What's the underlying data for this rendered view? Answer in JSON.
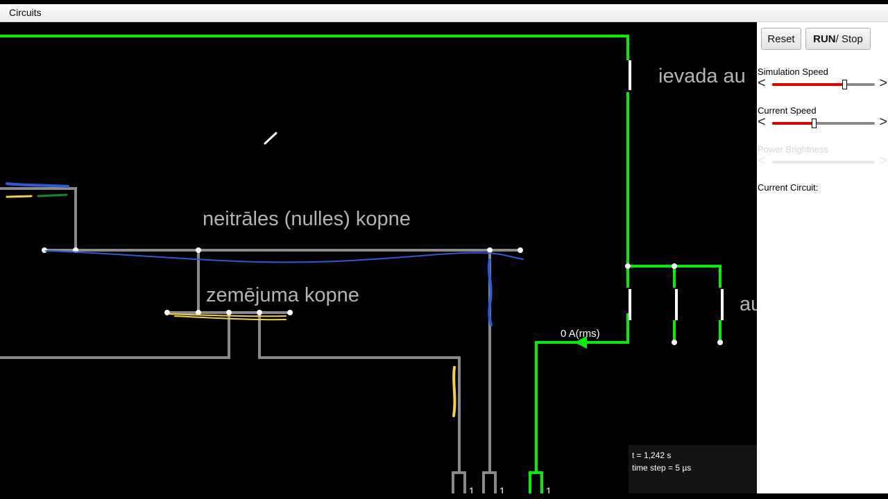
{
  "menubar": {
    "circuits_label": "Circuits"
  },
  "canvas": {
    "label_neutral_bus": "neitrāles (nulles) kopne",
    "label_ground_bus": "zemējuma kopne",
    "label_input": "ievada au",
    "label_right": "au",
    "current_readout": "0 A(rms)",
    "terminal_labels": [
      "1",
      "1",
      "1"
    ],
    "colors": {
      "live_wire": "#00ee00",
      "neutral_wire": "#8a8a8a",
      "blue_mark": "#2a5bd8",
      "yellow_mark": "#f2d23c",
      "green_mark": "#0a8a2a"
    }
  },
  "info": {
    "time": "t = 1,242 s",
    "time_step": "time step = 5 µs"
  },
  "panel": {
    "reset_label": "Reset",
    "run_label": "RUN",
    "stop_label": " / Stop",
    "simulation_speed_label": "Simulation Speed",
    "simulation_speed_value": 0.71,
    "current_speed_label": "Current Speed",
    "current_speed_value": 0.41,
    "power_brightness_label": "Power Brightness",
    "current_circuit_label": "Current Circuit:",
    "arrow_left": "<",
    "arrow_right": ">"
  }
}
